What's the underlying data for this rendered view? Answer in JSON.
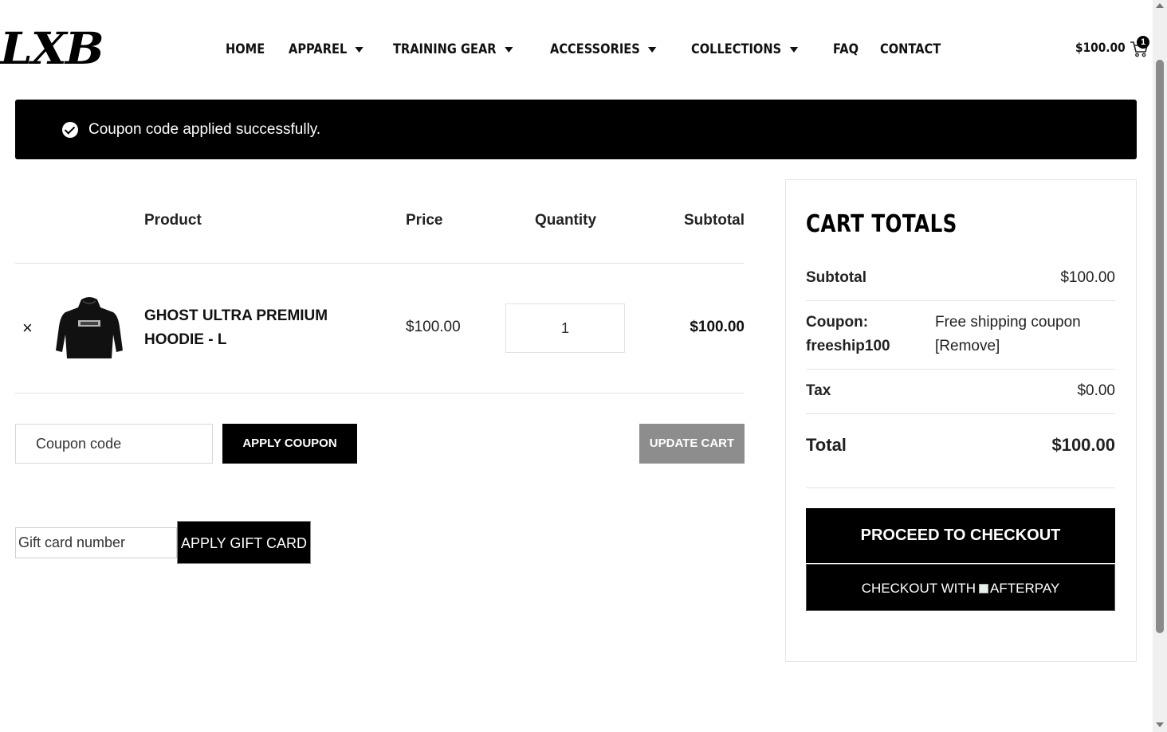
{
  "header": {
    "logo": "LXB",
    "nav": [
      {
        "label": "HOME",
        "dropdown": false
      },
      {
        "label": "APPAREL",
        "dropdown": true
      },
      {
        "label": "TRAINING GEAR",
        "dropdown": true
      },
      {
        "label": "ACCESSORIES",
        "dropdown": true
      },
      {
        "label": "COLLECTIONS",
        "dropdown": true
      },
      {
        "label": "FAQ",
        "dropdown": false
      },
      {
        "label": "CONTACT",
        "dropdown": false
      }
    ],
    "cart_amount": "$100.00",
    "cart_count": "1"
  },
  "notice": {
    "message": "Coupon code applied successfully.",
    "icon": "check-circle-icon"
  },
  "cart_table": {
    "headers": {
      "product": "Product",
      "price": "Price",
      "quantity": "Quantity",
      "subtotal": "Subtotal"
    },
    "items": [
      {
        "name": "GHOST ULTRA PREMIUM HOODIE - L",
        "price": "$100.00",
        "quantity": "1",
        "subtotal": "$100.00",
        "remove": "×"
      }
    ]
  },
  "coupon": {
    "placeholder": "Coupon code",
    "apply_label": "APPLY COUPON",
    "update_label": "UPDATE CART"
  },
  "gift_card": {
    "placeholder": "Gift card number",
    "apply_label": "APPLY GIFT CARD"
  },
  "totals": {
    "title": "CART TOTALS",
    "subtotal_label": "Subtotal",
    "subtotal_value": "$100.00",
    "coupon_label_line1": "Coupon:",
    "coupon_label_line2": "freeship100",
    "coupon_value": "Free shipping coupon",
    "coupon_remove": "[Remove]",
    "tax_label": "Tax",
    "tax_value": "$0.00",
    "total_label": "Total",
    "total_value": "$100.00",
    "checkout_label": "PROCEED TO CHECKOUT",
    "afterpay_prefix": "CHECKOUT WITH",
    "afterpay_alt": "AFTERPAY"
  },
  "colors": {
    "primary": "#000000",
    "muted_button": "#8d8d8d",
    "border": "#e3e3e3"
  }
}
